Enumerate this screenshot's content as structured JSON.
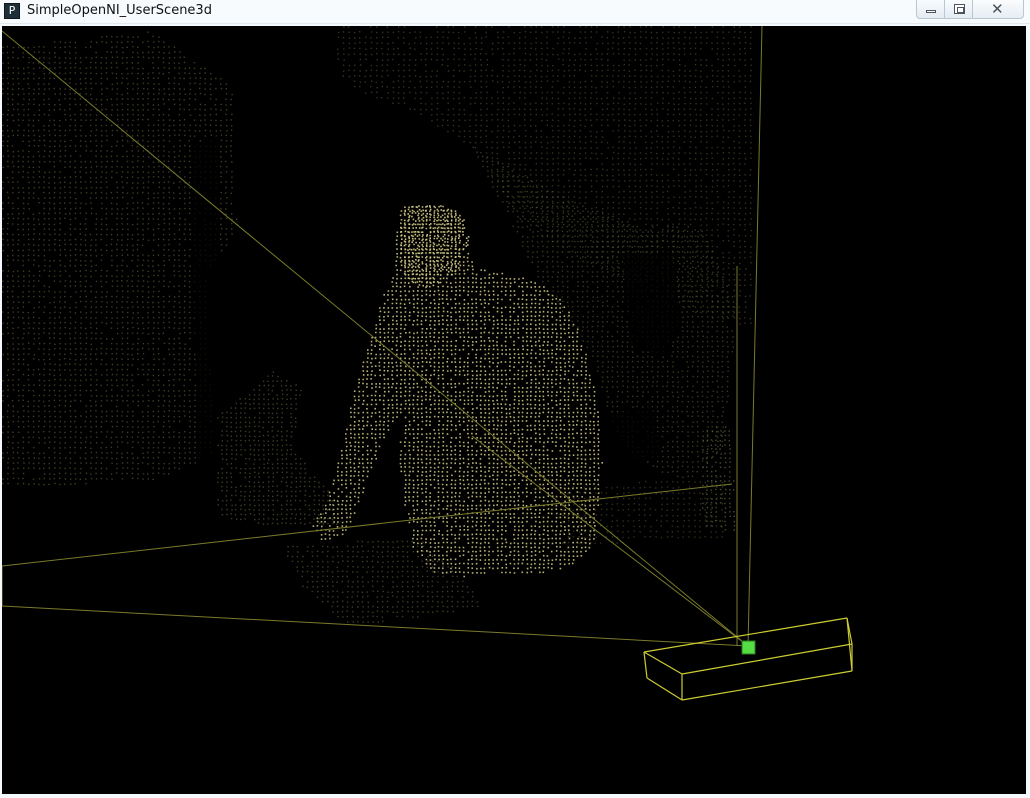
{
  "window": {
    "title": "SimpleOpenNI_UserScene3d",
    "app_icon_glyph": "P",
    "icons": {
      "app": "processing-app-icon",
      "minimize": "minimize-icon",
      "maximize": "maximize-icon",
      "close": "close-icon"
    }
  },
  "scene": {
    "background_color": "#000000",
    "point_color_dim": "#8a8a55",
    "point_color_user": "#d8d08a",
    "frustum_color": "#7a7a2a",
    "sensor_box_color": "#cccc33",
    "sensor_center_color": "#55dd44"
  }
}
